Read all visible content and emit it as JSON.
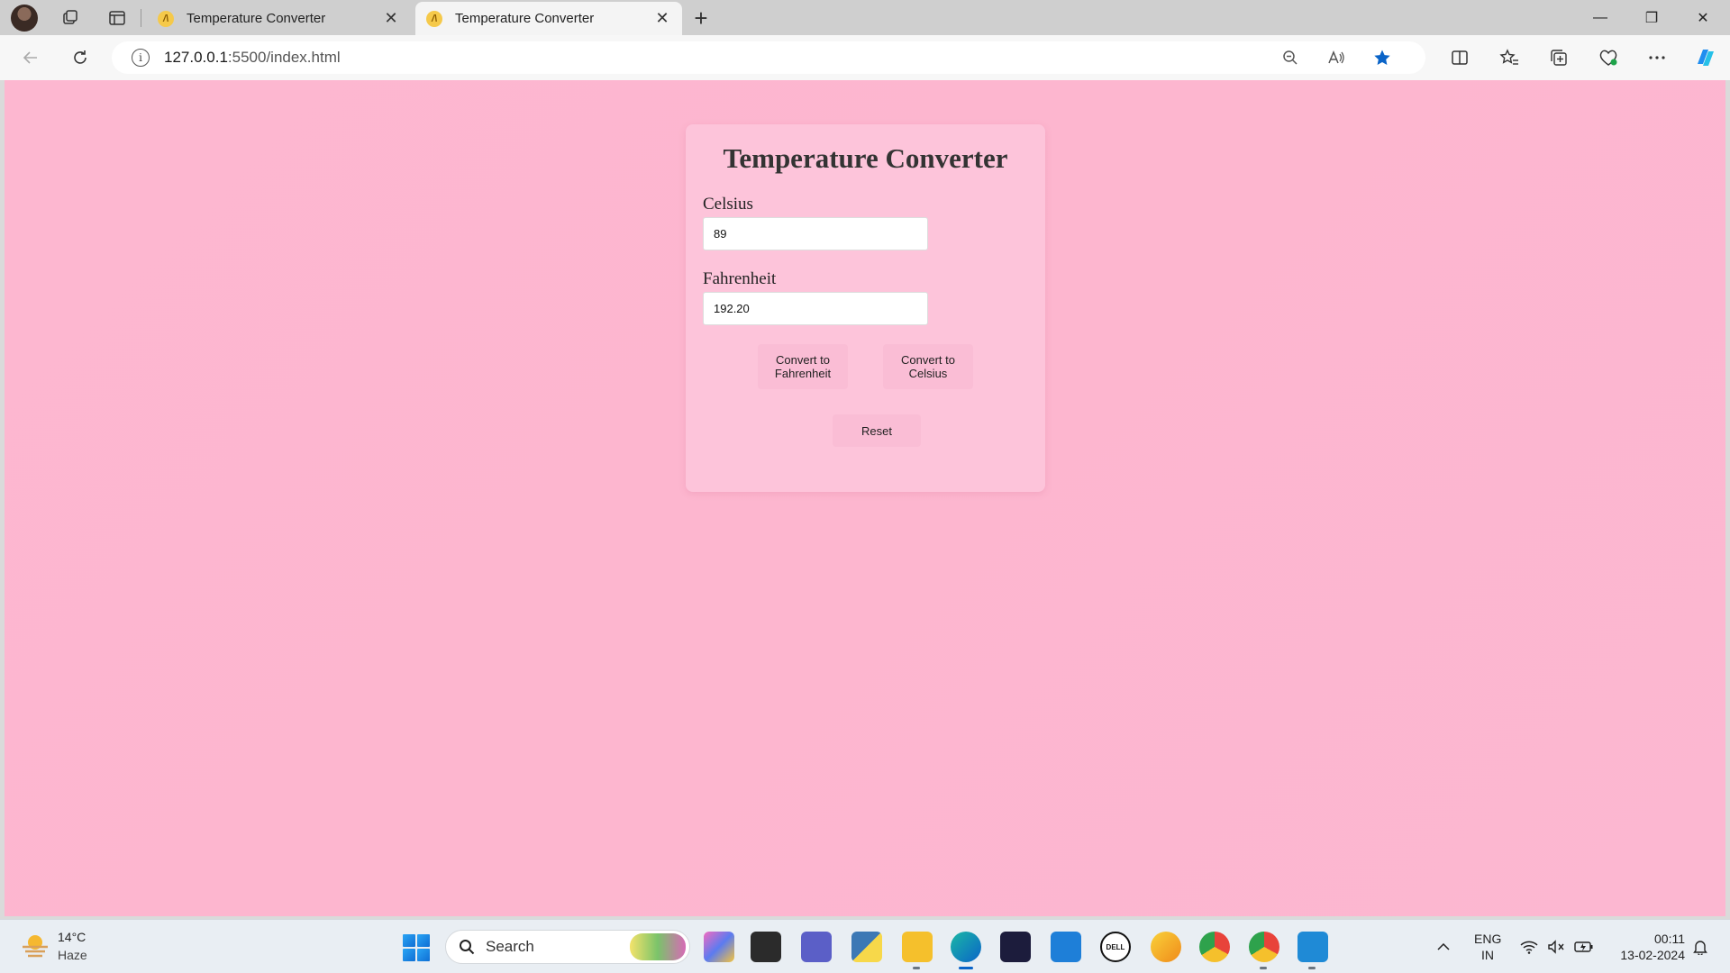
{
  "browser": {
    "tabs": [
      {
        "title": "Temperature Converter",
        "active": false
      },
      {
        "title": "Temperature Converter",
        "active": true
      }
    ],
    "url_host": "127.0.0.1",
    "url_rest": ":5500/index.html",
    "tab_close_glyph": "✕",
    "new_tab_glyph": "+",
    "window_controls": {
      "minimize": "—",
      "restore": "❐",
      "close": "✕"
    },
    "favicon_glyph": "/\\"
  },
  "converter": {
    "title": "Temperature Converter",
    "celsius_label": "Celsius",
    "celsius_value": "89",
    "fahrenheit_label": "Fahrenheit",
    "fahrenheit_value": "192.20",
    "to_fahrenheit_line1": "Convert to",
    "to_fahrenheit_line2": "Fahrenheit",
    "to_celsius_line1": "Convert to",
    "to_celsius_line2": "Celsius",
    "reset_label": "Reset"
  },
  "taskbar": {
    "weather_temp": "14°C",
    "weather_desc": "Haze",
    "search_label": "Search",
    "lang_line1": "ENG",
    "lang_line2": "IN",
    "time": "00:11",
    "date": "13-02-2024"
  },
  "colors": {
    "page_bg": "#fdb7d0",
    "card_bg": "#fdc4da",
    "button_bg": "#fabdd5",
    "accent_blue": "#0a64c8"
  }
}
